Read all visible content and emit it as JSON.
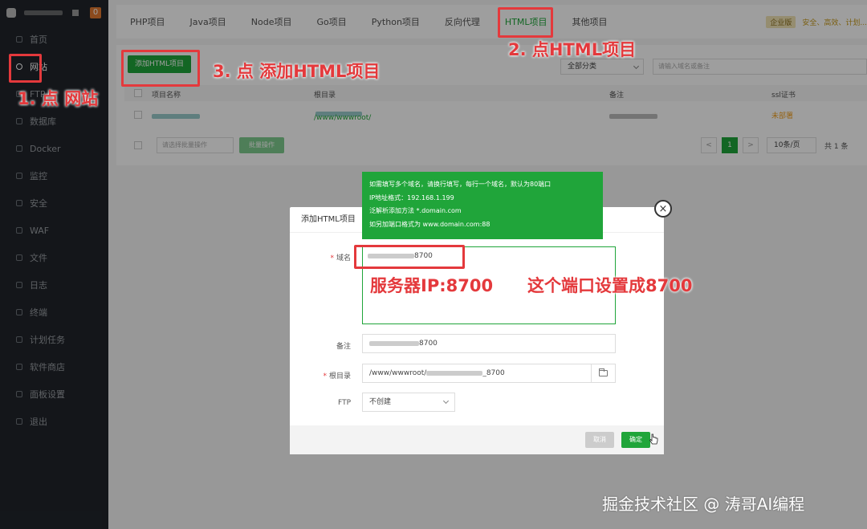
{
  "sidebar": {
    "badge": "0",
    "items": [
      {
        "label": "首页"
      },
      {
        "label": "网站"
      },
      {
        "label": "FTP"
      },
      {
        "label": "数据库"
      },
      {
        "label": "Docker"
      },
      {
        "label": "监控"
      },
      {
        "label": "安全"
      },
      {
        "label": "WAF"
      },
      {
        "label": "文件"
      },
      {
        "label": "日志"
      },
      {
        "label": "终端"
      },
      {
        "label": "计划任务"
      },
      {
        "label": "软件商店"
      },
      {
        "label": "面板设置"
      },
      {
        "label": "退出"
      }
    ]
  },
  "topbar": {
    "tabs": [
      "PHP项目",
      "Java项目",
      "Node项目",
      "Go项目",
      "Python项目",
      "反向代理",
      "HTML项目",
      "其他项目"
    ],
    "active_tab": "HTML项目",
    "pro_badge": "企业版",
    "safety_text": "安全、高效、计划..."
  },
  "toolbar": {
    "add_button": "添加HTML项目",
    "category_select": "全部分类",
    "search_placeholder": "请输入域名或备注"
  },
  "table": {
    "headers": [
      "项目名称",
      "根目录",
      "备注",
      "ssl证书"
    ],
    "row": {
      "root_prefix": "/www/wwwroot/",
      "ssl": "未部署"
    }
  },
  "footer": {
    "batch_select": "请选择批量操作",
    "batch_button": "批量操作",
    "page_prev": "<",
    "page_current": "1",
    "page_next": ">",
    "page_size": "10条/页",
    "total": "共 1 条"
  },
  "tooltip": {
    "lines": [
      "如需填写多个域名，请换行填写，每行一个域名，默认为80端口",
      "IP地址格式：192.168.1.199",
      "泛解析添加方法 *.domain.com",
      "如另加端口格式为 www.domain.com:88"
    ]
  },
  "modal": {
    "title": "添加HTML项目",
    "domain_label": "域名",
    "domain_value_suffix": "8700",
    "remark_label": "备注",
    "remark_value_suffix": "8700",
    "root_label": "根目录",
    "root_value_prefix": "/www/wwwroot/",
    "root_value_suffix": "_8700",
    "ftp_label": "FTP",
    "ftp_value": "不创建",
    "cancel": "取消",
    "confirm": "确定",
    "close": "×"
  },
  "annotations": {
    "step1": "1. 点 网站",
    "step2": "2. 点HTML项目",
    "step3": "3. 点 添加HTML项目",
    "server_ip": "服务器IP:8700",
    "port_note": "这个端口设置成8700"
  },
  "watermark": "掘金技术社区 @ 涛哥AI编程"
}
